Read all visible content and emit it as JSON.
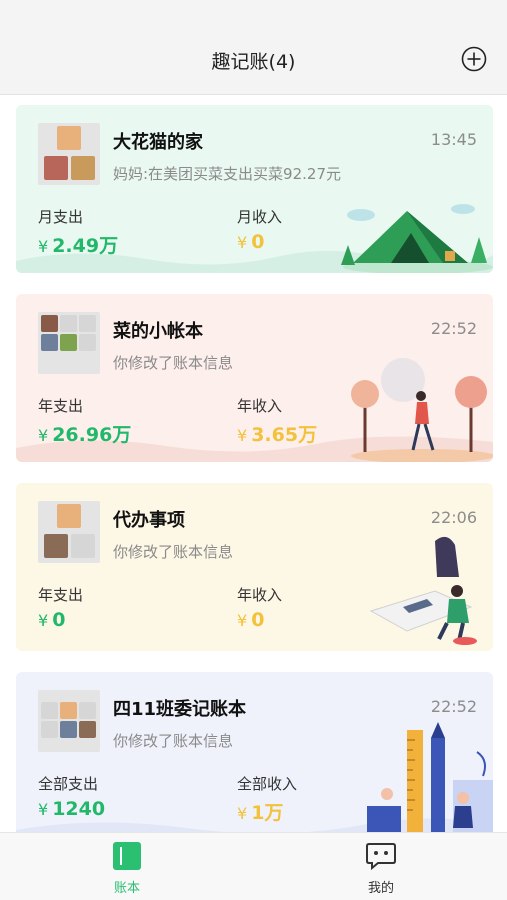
{
  "header": {
    "title": "趣记账(4)",
    "add_icon": "plus-circle-icon"
  },
  "books": [
    {
      "name": "大花猫的家",
      "time": "13:45",
      "subtitle": "妈妈:在美团买菜支出买菜92.27元",
      "expense_label": "月支出",
      "expense_currency": "¥",
      "expense_value": "2.49万",
      "income_label": "月收入",
      "income_currency": "¥",
      "income_value": "0",
      "background": "#e9f8f1",
      "illustration": "camping-tent"
    },
    {
      "name": "菜的小帐本",
      "time": "22:52",
      "subtitle": "你修改了账本信息",
      "expense_label": "年支出",
      "expense_currency": "¥",
      "expense_value": "26.96万",
      "income_label": "年收入",
      "income_currency": "¥",
      "income_value": "3.65万",
      "background": "#fdefec",
      "illustration": "autumn-walk"
    },
    {
      "name": "代办事项",
      "time": "22:06",
      "subtitle": "你修改了账本信息",
      "expense_label": "年支出",
      "expense_currency": "¥",
      "expense_value": "0",
      "income_label": "年收入",
      "income_currency": "¥",
      "income_value": "0",
      "background": "#fdf7e6",
      "illustration": "person-at-desk"
    },
    {
      "name": "四11班委记账本",
      "time": "22:52",
      "subtitle": "你修改了账本信息",
      "expense_label": "全部支出",
      "expense_currency": "¥",
      "expense_value": "1240",
      "income_label": "全部收入",
      "income_currency": "¥",
      "income_value": "1万",
      "background": "#eff2fb",
      "illustration": "ruler-and-pencil"
    }
  ],
  "tabs": [
    {
      "label": "账本",
      "icon": "book-icon",
      "active": true
    },
    {
      "label": "我的",
      "icon": "chat-face-icon",
      "active": false
    }
  ],
  "colors": {
    "expense": "#22b86a",
    "income": "#f2c23c",
    "tab_active": "#2bbf72"
  }
}
